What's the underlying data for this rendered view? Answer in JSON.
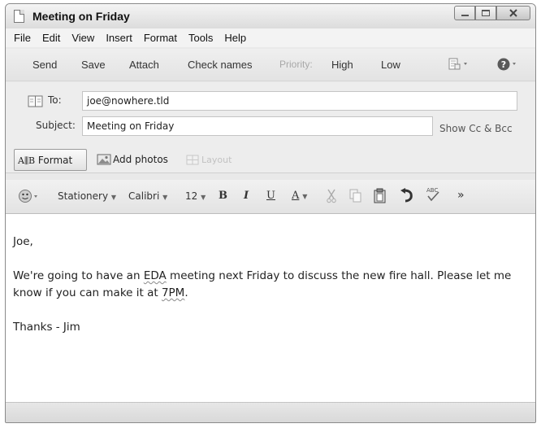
{
  "window": {
    "title": "Meeting on Friday"
  },
  "menu": [
    "File",
    "Edit",
    "View",
    "Insert",
    "Format",
    "Tools",
    "Help"
  ],
  "toolbar": {
    "send": "Send",
    "save": "Save",
    "attach": "Attach",
    "check_names": "Check names",
    "priority_label": "Priority:",
    "priority_high": "High",
    "priority_low": "Low"
  },
  "header": {
    "to_label": "To:",
    "to_value": "joe@nowhere.tld",
    "subject_label": "Subject:",
    "subject_value": "Meeting on Friday",
    "show_cc_bcc": "Show Cc & Bcc"
  },
  "format_row": {
    "format_label": "Format",
    "add_photos": "Add photos",
    "layout": "Layout"
  },
  "rich_toolbar": {
    "stationery": "Stationery",
    "font": "Calibri",
    "size": "12",
    "bold": "B",
    "italic": "I",
    "underline": "U",
    "font_color": "A",
    "more": "»"
  },
  "message": {
    "greeting": "Joe,",
    "line1_a": "We're going to have an ",
    "line1_word1": "EDA",
    "line1_b": " meeting next Friday to discuss the new fire hall. Please let me know if you can make it at ",
    "line1_word2": "7PM",
    "line1_c": ".",
    "signoff": "Thanks - Jim"
  }
}
